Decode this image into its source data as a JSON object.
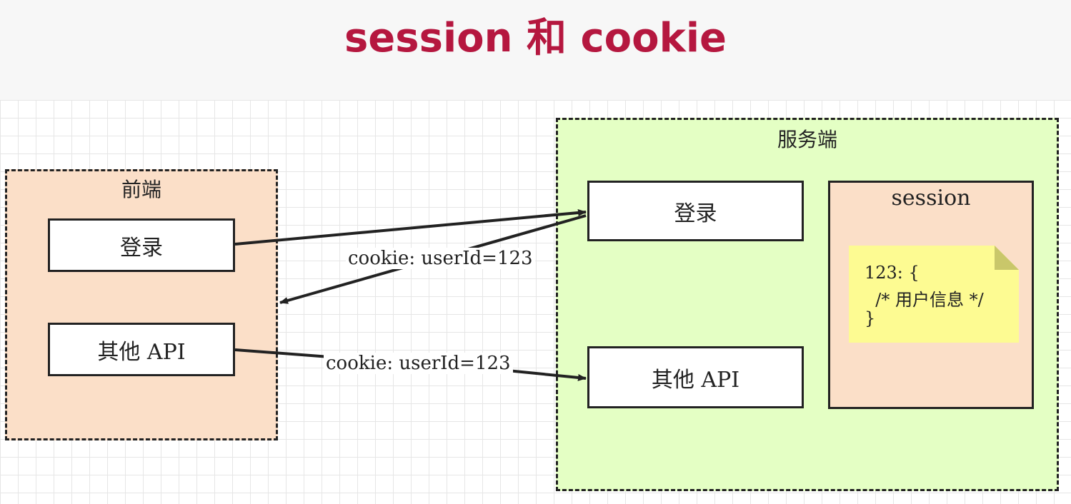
{
  "title": "session 和 cookie",
  "colors": {
    "title": "#b5173f",
    "frontend_fill": "#fbdfc8",
    "server_fill": "#e4ffc4",
    "session_fill": "#fbdfc8",
    "note_fill": "#fdfb92",
    "note_fold": "#c9c76a",
    "stroke": "#222222"
  },
  "frontend": {
    "label": "前端",
    "login": "登录",
    "other_api": "其他 API"
  },
  "server": {
    "label": "服务端",
    "login": "登录",
    "other_api": "其他 API",
    "session": {
      "label": "session",
      "note_lines": [
        "123: {",
        "  /* 用户信息 */",
        "}"
      ]
    }
  },
  "edges": {
    "response_cookie": "cookie: userId=123",
    "request_cookie": "cookie: userId=123"
  }
}
